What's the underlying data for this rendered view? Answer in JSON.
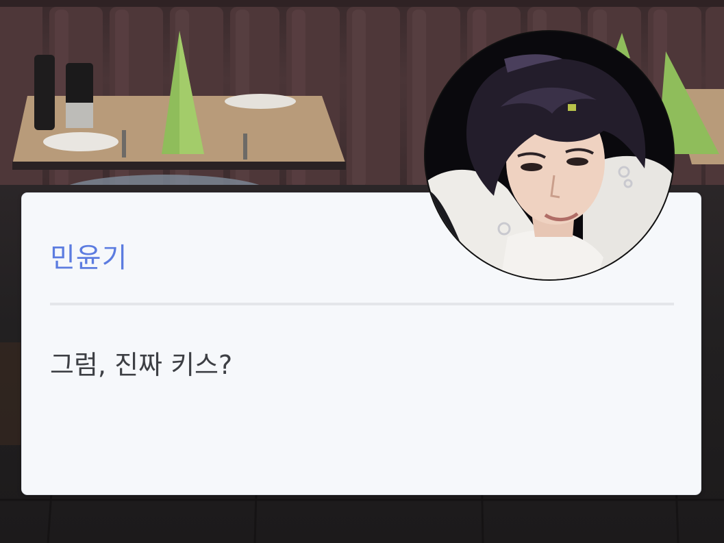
{
  "dialog": {
    "speaker": "민윤기",
    "message": "그럼, 진짜 키스?"
  },
  "portrait": {
    "icon": "character-portrait"
  },
  "colors": {
    "speaker": "#5c7ce0",
    "message": "#3d3f44",
    "dialog_bg": "#f6f8fb"
  }
}
